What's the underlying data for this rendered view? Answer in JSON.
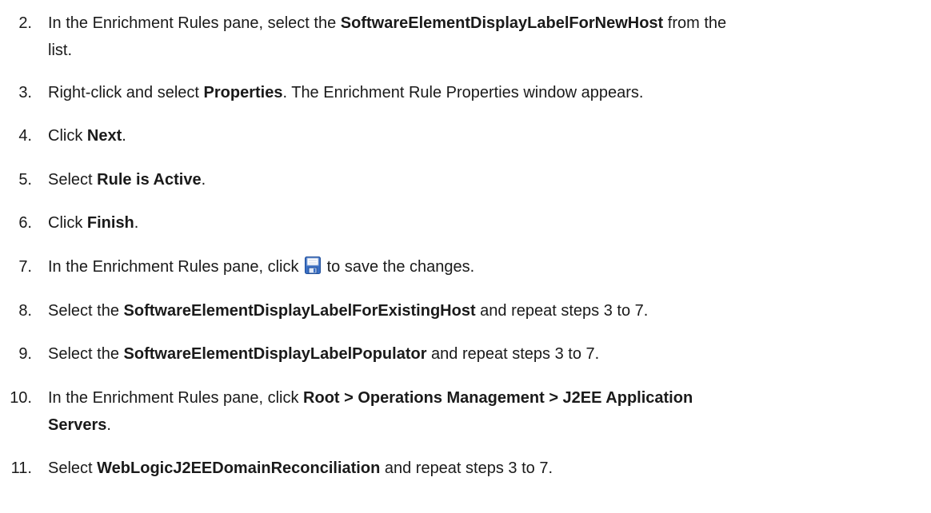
{
  "steps": [
    {
      "number": "2.",
      "parts": [
        {
          "t": "In the Enrichment Rules pane, select the "
        },
        {
          "t": "SoftwareElementDisplayLabelForNewHost",
          "b": true
        },
        {
          "t": " from the"
        }
      ],
      "continuation": "list."
    },
    {
      "number": "3.",
      "parts": [
        {
          "t": "Right-click and select "
        },
        {
          "t": "Properties",
          "b": true
        },
        {
          "t": ". The Enrichment Rule Properties window appears."
        }
      ]
    },
    {
      "number": "4.",
      "parts": [
        {
          "t": "Click "
        },
        {
          "t": "Next",
          "b": true
        },
        {
          "t": "."
        }
      ]
    },
    {
      "number": "5.",
      "parts": [
        {
          "t": "Select "
        },
        {
          "t": "Rule is Active",
          "b": true
        },
        {
          "t": "."
        }
      ]
    },
    {
      "number": "6.",
      "parts": [
        {
          "t": "Click "
        },
        {
          "t": "Finish",
          "b": true
        },
        {
          "t": "."
        }
      ]
    },
    {
      "number": "7.",
      "parts": [
        {
          "t": "In the Enrichment Rules pane, click "
        },
        {
          "icon": "save-icon"
        },
        {
          "t": " to save the changes."
        }
      ]
    },
    {
      "number": "8.",
      "parts": [
        {
          "t": "Select the "
        },
        {
          "t": "SoftwareElementDisplayLabelForExistingHost",
          "b": true
        },
        {
          "t": " and repeat steps 3 to 7."
        }
      ]
    },
    {
      "number": "9.",
      "parts": [
        {
          "t": "Select the "
        },
        {
          "t": "SoftwareElementDisplayLabelPopulator",
          "b": true
        },
        {
          "t": " and repeat steps 3 to 7."
        }
      ]
    },
    {
      "number": "10.",
      "parts": [
        {
          "t": "In the Enrichment Rules pane, click "
        },
        {
          "t": "Root > Operations Management > J2EE Application",
          "b": true
        }
      ],
      "continuation": "Servers",
      "continuation_bold": true,
      "continuation_suffix": "."
    },
    {
      "number": "11.",
      "parts": [
        {
          "t": "Select "
        },
        {
          "t": "WebLogicJ2EEDomainReconciliation",
          "b": true
        },
        {
          "t": " and repeat steps 3 to 7."
        }
      ]
    }
  ],
  "colors": {
    "text": "#1a1a1a",
    "icon_blue": "#3a6fc4"
  }
}
